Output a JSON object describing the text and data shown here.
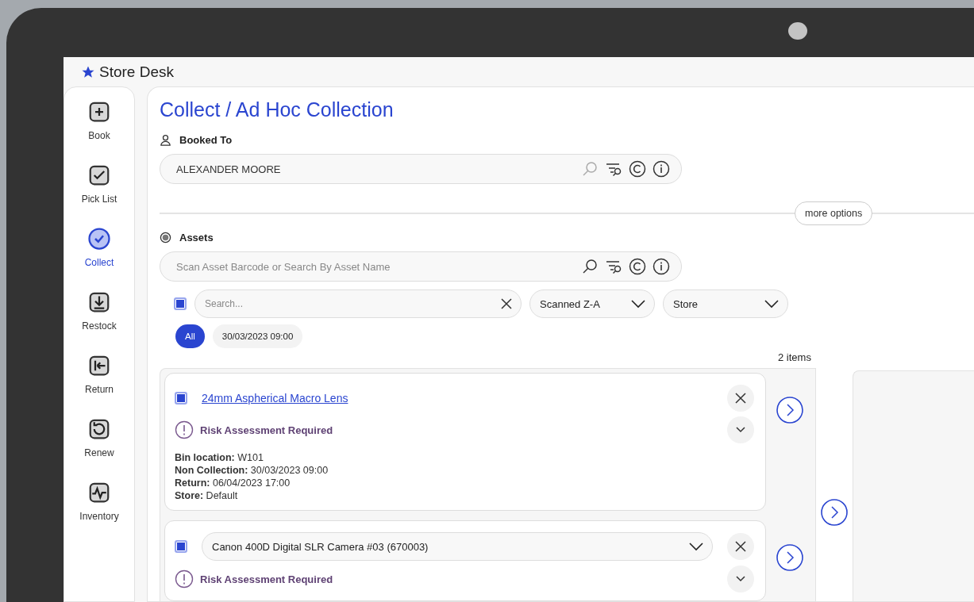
{
  "app": {
    "title": "Store Desk"
  },
  "sidebar": {
    "items": [
      {
        "label": "Book",
        "selected": false
      },
      {
        "label": "Pick List",
        "selected": false
      },
      {
        "label": "Collect",
        "selected": true
      },
      {
        "label": "Restock",
        "selected": false
      },
      {
        "label": "Return",
        "selected": false
      },
      {
        "label": "Renew",
        "selected": false
      },
      {
        "label": "Inventory",
        "selected": false
      }
    ]
  },
  "page": {
    "title": "Collect / Ad Hoc Collection"
  },
  "booked_to": {
    "label": "Booked To",
    "value": "ALEXANDER MOORE"
  },
  "more_options": "more options",
  "assets": {
    "label": "Assets",
    "placeholder": "Scan Asset Barcode or Search By Asset Name"
  },
  "filter": {
    "checked": true,
    "search_placeholder": "Search...",
    "sort": "Scanned Z-A",
    "store": "Store"
  },
  "chips": [
    {
      "label": "All",
      "selected": true
    },
    {
      "label": "30/03/2023 09:00",
      "selected": false
    }
  ],
  "count": "2 items",
  "cards": [
    {
      "kind": "link",
      "checked": true,
      "name": "24mm Aspherical Macro Lens",
      "warning": "Risk Assessment Required",
      "details": [
        {
          "label": "Bin location:",
          "value": "W101"
        },
        {
          "label": "Non Collection:",
          "value": "30/03/2023 09:00"
        },
        {
          "label": "Return:",
          "value": "06/04/2023 17:00"
        },
        {
          "label": "Store:",
          "value": "Default"
        }
      ]
    },
    {
      "kind": "dropdown",
      "checked": true,
      "name": "Canon 400D Digital SLR Camera #03 (670003)",
      "warning": "Risk Assessment Required"
    }
  ]
}
